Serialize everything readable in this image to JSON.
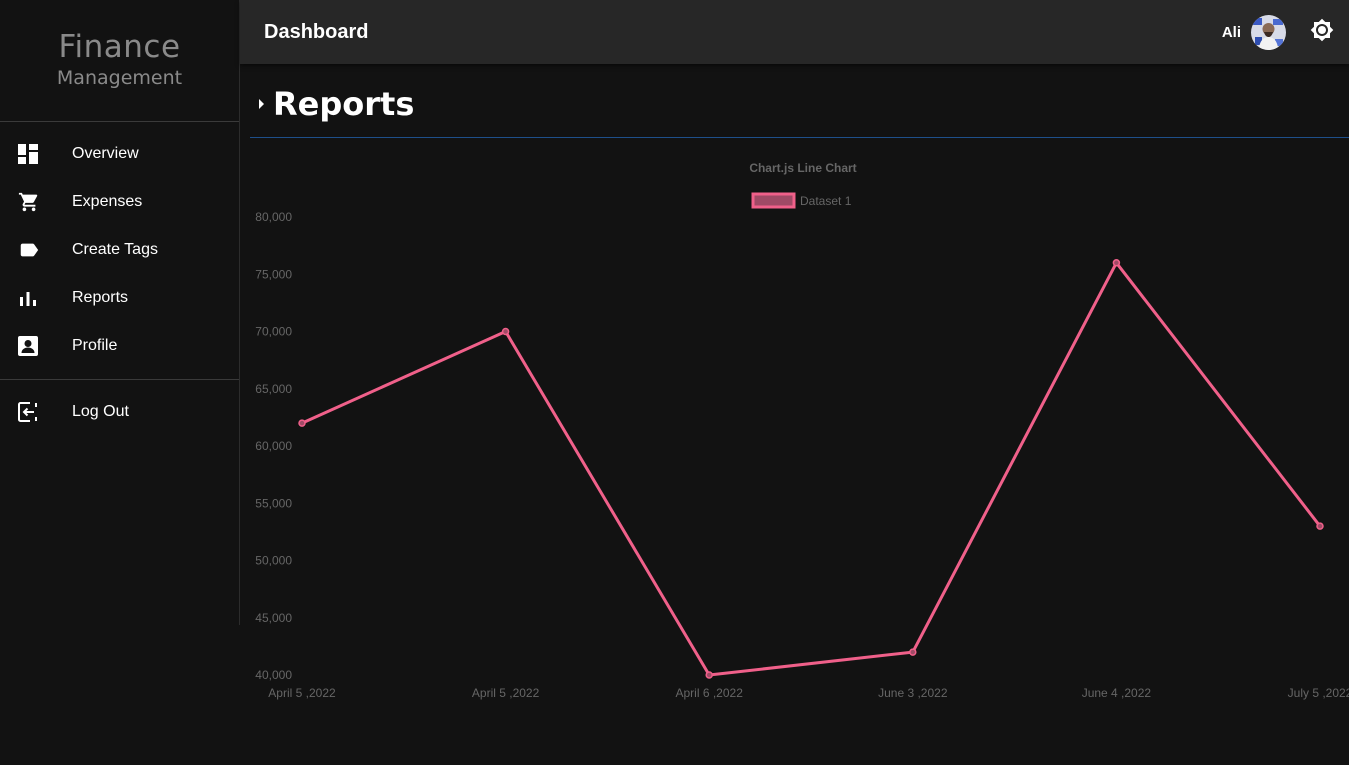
{
  "brand": {
    "title": "Finance",
    "subtitle": "Management"
  },
  "nav": {
    "items": [
      {
        "label": "Overview",
        "icon": "dashboard-icon"
      },
      {
        "label": "Expenses",
        "icon": "cart-icon"
      },
      {
        "label": "Create Tags",
        "icon": "tag-icon"
      },
      {
        "label": "Reports",
        "icon": "bar-chart-icon"
      },
      {
        "label": "Profile",
        "icon": "account-box-icon"
      }
    ],
    "logout": {
      "label": "Log Out",
      "icon": "logout-icon"
    }
  },
  "topbar": {
    "title": "Dashboard",
    "user_name": "Ali",
    "theme_icon": "brightness-icon"
  },
  "page": {
    "title": "Reports"
  },
  "colors": {
    "accent": "#f0608a",
    "background": "#121212",
    "topbar": "#272727",
    "divider": "#1e4f8a"
  },
  "chart_data": {
    "type": "line",
    "title": "Chart.js Line Chart",
    "categories": [
      "April 5 ,2022",
      "April 5 ,2022",
      "April 6 ,2022",
      "June 3 ,2022",
      "June 4 ,2022",
      "July 5 ,2022"
    ],
    "series": [
      {
        "name": "Dataset 1",
        "values": [
          62000,
          70000,
          40000,
          42000,
          76000,
          53000
        ]
      }
    ],
    "ylim": [
      40000,
      80000
    ],
    "yticks": [
      "80,000",
      "75,000",
      "70,000",
      "65,000",
      "60,000",
      "55,000",
      "50,000",
      "45,000",
      "40,000"
    ],
    "legend": "top",
    "grid": false
  }
}
